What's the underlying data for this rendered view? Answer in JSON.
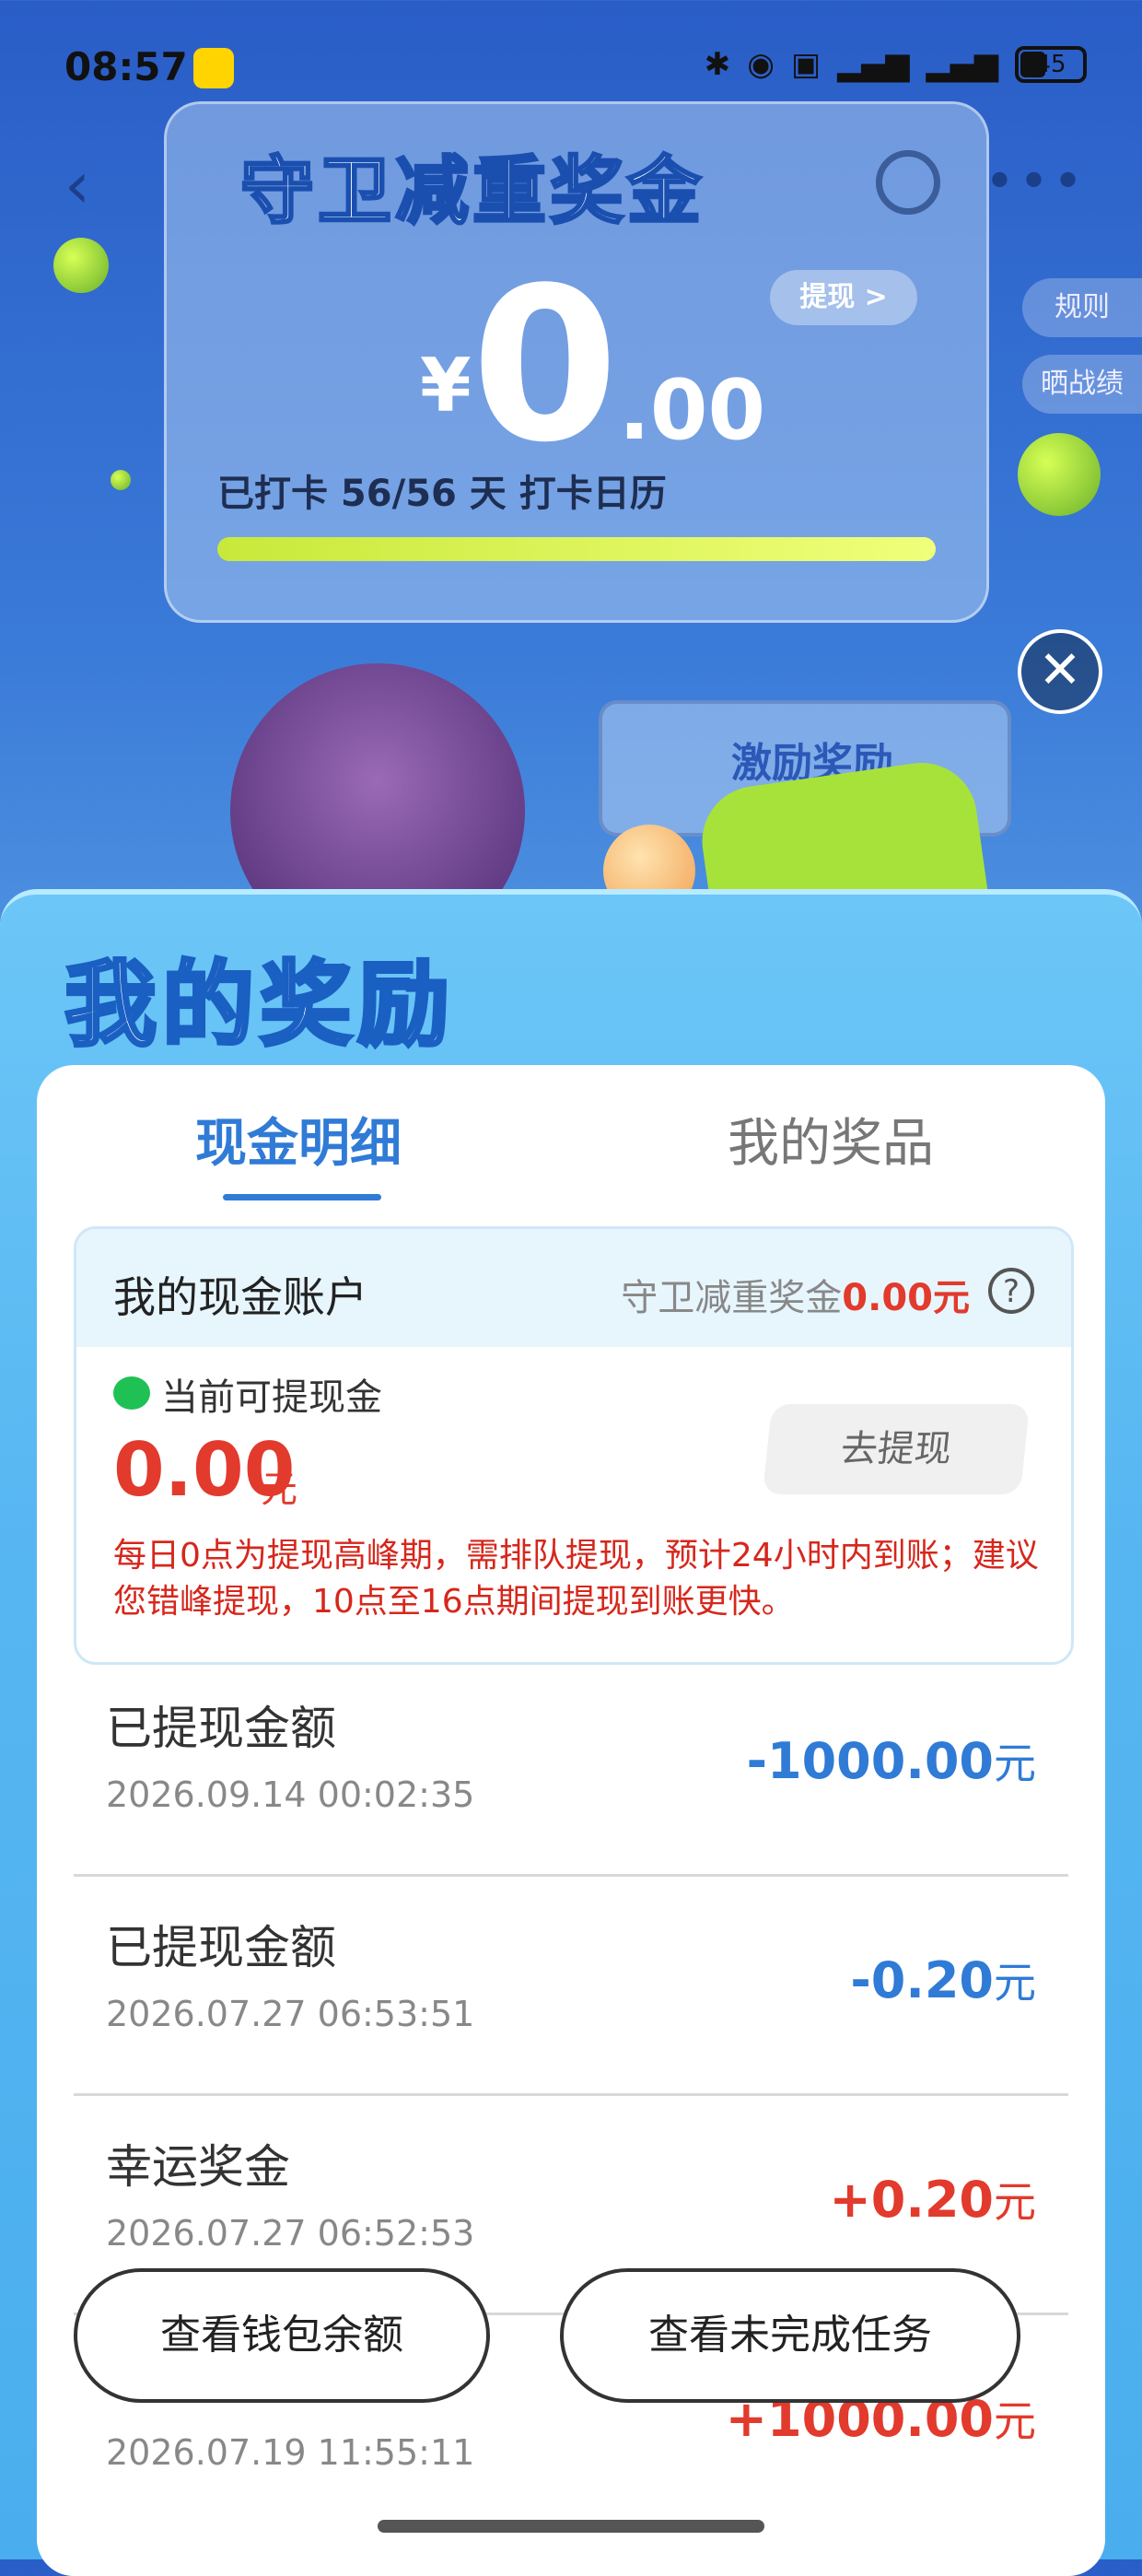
{
  "status_bar": {
    "time": "08:57",
    "icons": [
      "app-notification-icon",
      "bluetooth-icon",
      "location-icon",
      "hd-icon",
      "signal-5g-icon",
      "signal-5g-icon",
      "battery-icon"
    ],
    "battery_level": "45"
  },
  "background": {
    "title": "守卫减重奖金",
    "withdraw_label": "提现 >",
    "amount_currency": "¥",
    "amount_integer": "0",
    "amount_decimal": ".00",
    "checkin_text": "已打卡 56/56 天  打卡日历",
    "side_rules": "规则",
    "side_share": "晒战绩",
    "sign_text": "激励奖励"
  },
  "sheet": {
    "title": "我的奖励",
    "tabs": [
      {
        "label": "现金明细",
        "active": true
      },
      {
        "label": "我的奖品",
        "active": false
      }
    ],
    "account": {
      "title": "我的现金账户",
      "fund_label": "守卫减重奖金",
      "fund_value": "0.00元",
      "available_label": "当前可提现金",
      "available_amount": "0.00",
      "available_unit": "元",
      "withdraw_button": "去提现",
      "notice": "每日0点为提现高峰期，需排队提现，预计24小时内到账；建议您错峰提现，10点至16点期间提现到账更快。"
    },
    "records": [
      {
        "title": "已提现金额",
        "time": "2026.09.14 00:02:35",
        "amount": "-1000.00",
        "unit": "元",
        "type": "negative"
      },
      {
        "title": "已提现金额",
        "time": "2026.07.27 06:53:51",
        "amount": "-0.20",
        "unit": "元",
        "type": "negative"
      },
      {
        "title": "幸运奖金",
        "time": "2026.07.27 06:52:53",
        "amount": "+0.20",
        "unit": "元",
        "type": "positive"
      },
      {
        "title": "",
        "time": "2026.07.19 11:55:11",
        "amount": "+1000.00",
        "unit": "元",
        "type": "positive"
      }
    ]
  },
  "floating_buttons": {
    "wallet_balance": "查看钱包余额",
    "unfinished_tasks": "查看未完成任务"
  },
  "colors": {
    "accent_blue": "#2f7bd6",
    "accent_red": "#e23a2c",
    "sheet_blue": "#56b6f1"
  }
}
